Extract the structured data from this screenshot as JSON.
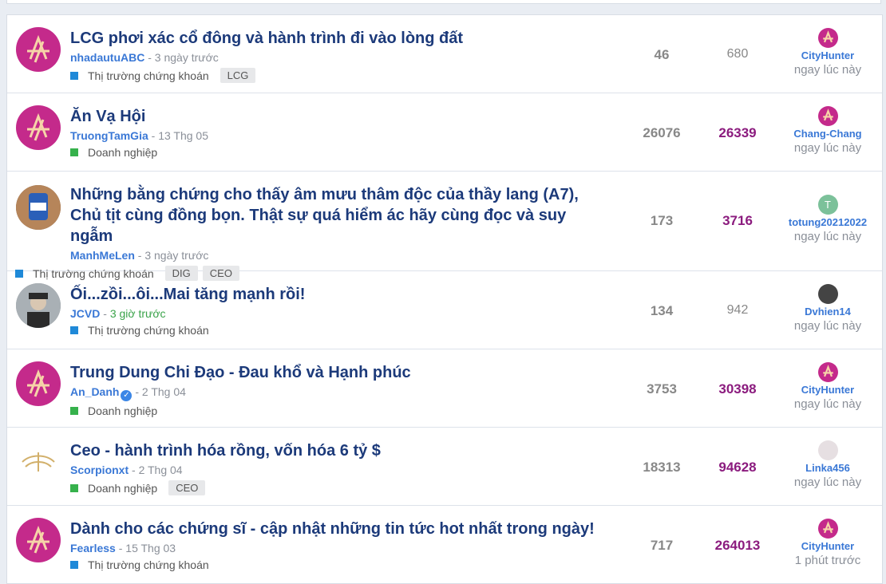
{
  "threads": [
    {
      "title": "LCG phơi xác cổ đông và hành trình đi vào lòng đất",
      "author": "nhadautuABC",
      "time": "3 ngày trước",
      "forum": "Thị trường chứng khoán",
      "forum_color": "blue",
      "tags": [
        "LCG"
      ],
      "replies": "46",
      "views": "680",
      "last_user": "CityHunter",
      "last_time": "ngay lúc này",
      "avatar": "brand",
      "last_avatar": "brand"
    },
    {
      "title": "Ăn Vạ Hội",
      "author": "TruongTamGia",
      "time": "13 Thg 05",
      "forum": "Doanh nghiệp",
      "forum_color": "green",
      "tags": [],
      "replies": "26076",
      "views": "26339",
      "last_user": "Chang-Chang",
      "last_time": "ngay lúc này",
      "avatar": "brand",
      "last_avatar": "brand"
    },
    {
      "title": "Những bằng chứng cho thấy âm mưu thâm độc của thầy lang (A7), Chủ tịt cùng đồng bọn. Thật sự quá hiểm ác hãy cùng đọc và suy ngẫm",
      "author": "ManhMeLen",
      "time": "3 ngày trước",
      "forum": "Thị trường chứng khoán",
      "forum_color": "blue",
      "tags": [
        "DIG",
        "CEO"
      ],
      "replies": "173",
      "views": "3716",
      "last_user": "totung20212022",
      "last_time": "ngay lúc này",
      "avatar": "photo1",
      "last_avatar": "letter-T"
    },
    {
      "title": "Ối...zồi...ôi...Mai tăng mạnh rồi!",
      "author": "JCVD",
      "time": "3 giờ trước",
      "forum": "Thị trường chứng khoán",
      "forum_color": "blue",
      "tags": [],
      "replies": "134",
      "views": "942",
      "last_user": "Dvhien14",
      "last_time": "ngay lúc này",
      "avatar": "photo2",
      "last_avatar": "dark-photo"
    },
    {
      "title": "Trung Dung Chi Đạo - Đau khổ và Hạnh phúc",
      "author": "An_Danh",
      "time": "2 Thg 04",
      "forum": "Doanh nghiệp",
      "forum_color": "green",
      "tags": [],
      "replies": "3753",
      "views": "30398",
      "last_user": "CityHunter",
      "last_time": "ngay lúc này",
      "avatar": "brand",
      "last_avatar": "brand",
      "verified": true
    },
    {
      "title": "Ceo - hành trình hóa rồng, vốn hóa 6 tỷ $",
      "author": "Scorpionxt",
      "time": "2 Thg 04",
      "forum": "Doanh nghiệp",
      "forum_color": "green",
      "tags": [
        "CEO"
      ],
      "replies": "18313",
      "views": "94628",
      "last_user": "Linka456",
      "last_time": "ngay lúc này",
      "avatar": "gold",
      "last_avatar": "light-photo"
    },
    {
      "title": "Dành cho các chứng sĩ - cập nhật những tin tức hot nhất trong ngày!",
      "author": "Fearless",
      "time": "15 Thg 03",
      "forum": "Thị trường chứng khoán",
      "forum_color": "blue",
      "tags": [],
      "replies": "717",
      "views": "264013",
      "last_user": "CityHunter",
      "last_time": "1 phút trước",
      "avatar": "brand",
      "last_avatar": "brand"
    }
  ],
  "colors": {
    "title": "#1c3a7a",
    "author": "#3a78d6",
    "hot_views": "#8b1b7e",
    "brand": "#c42a8b"
  }
}
